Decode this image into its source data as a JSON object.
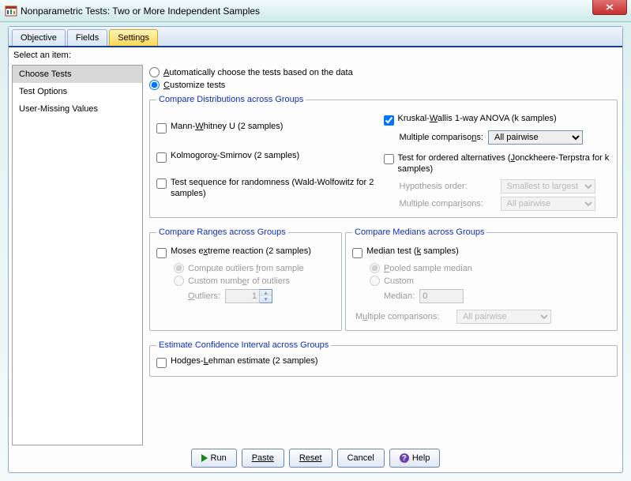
{
  "window": {
    "title": "Nonparametric Tests: Two or More Independent Samples"
  },
  "tabs": {
    "objective": "Objective",
    "fields": "Fields",
    "settings": "Settings"
  },
  "sidebar": {
    "header": "Select an item:",
    "items": [
      "Choose Tests",
      "Test Options",
      "User-Missing Values"
    ]
  },
  "modes": {
    "auto": "Automatically choose the tests based on the data",
    "custom": "Customize tests"
  },
  "g1": {
    "legend": "Compare Distributions across Groups",
    "mw_pre": "Mann-",
    "mw_u": "W",
    "mw_post": "hitney U (2 samples)",
    "ks_pre": "Kolmogoro",
    "ks_u": "v",
    "ks_post": "-Smirnov (2 samples)",
    "seq": "Test sequence for randomness (Wald-Wolfowitz for 2 samples)",
    "kw_pre": "Kruskal-",
    "kw_u": "W",
    "kw_post": "allis 1-way ANOVA (k samples)",
    "mcomp_pre": "Multiple compariso",
    "mcomp_u": "n",
    "mcomp_post": "s:",
    "mcomp_val": "All pairwise",
    "jt_pre": "Test for ordered alternatives (",
    "jt_u": "J",
    "jt_post": "onckheere-Terpstra for k samples)",
    "hyp_label": "Hypothesis order:",
    "hyp_val": "Smallest to largest",
    "mcomp2_pre": "Multiple compar",
    "mcomp2_u": "i",
    "mcomp2_post": "sons:",
    "mcomp2_val": "All pairwise"
  },
  "g2": {
    "legend": "Compare Ranges across Groups",
    "moses_pre": "Moses e",
    "moses_u": "x",
    "moses_post": "treme reaction (2 samples)",
    "r1_pre": "Compute outliers ",
    "r1_u": "f",
    "r1_post": "rom sample",
    "r2_pre": "Custom numb",
    "r2_u": "e",
    "r2_post": "r of outliers",
    "out_pre": "",
    "out_u": "O",
    "out_post": "utliers:",
    "out_val": "1"
  },
  "g3": {
    "legend": "Compare Medians across Groups",
    "med_pre": "Median test (",
    "med_u": "k",
    "med_post": " samples)",
    "r1_u": "P",
    "r1_post": "ooled sample median",
    "r2": "Custom",
    "med_lbl": "Median:",
    "med_val": "0",
    "mc_pre": "M",
    "mc_u": "u",
    "mc_post": "ltiple comparisons:",
    "mc_val": "All pairwise"
  },
  "g4": {
    "legend": "Estimate Confidence Interval across Groups",
    "hl_pre": "Hodges-",
    "hl_u": "L",
    "hl_post": "ehman estimate (2 samples)"
  },
  "buttons": {
    "run": "Run",
    "paste": "Paste",
    "reset": "Reset",
    "cancel": "Cancel",
    "help": "Help"
  }
}
